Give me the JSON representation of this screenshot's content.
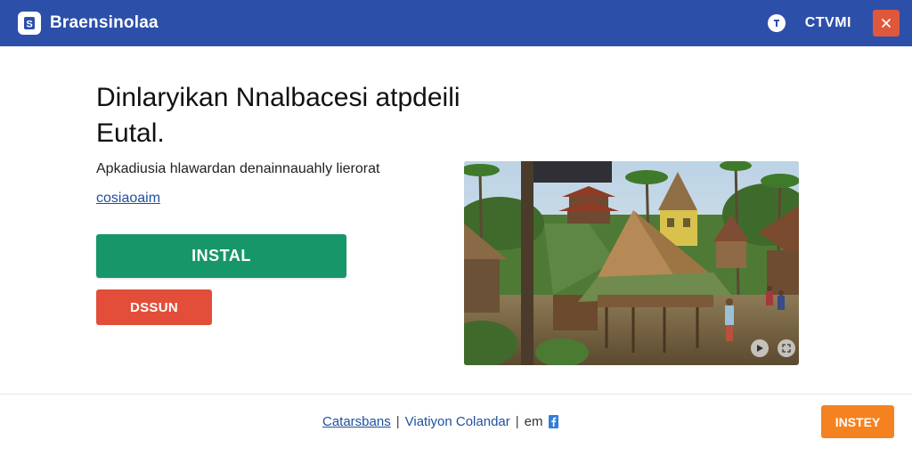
{
  "header": {
    "brand_name": "Braensinolaa",
    "account_label": "CTVMI",
    "colors": {
      "bar": "#2c4fa9",
      "close": "#e0583c"
    },
    "icons": {
      "logo": "brand-logo-icon",
      "help": "help-icon",
      "close": "close-icon"
    }
  },
  "main": {
    "headline_line1": "Dinlaryikan Nnalbacesi atpdeili",
    "headline_line2": "Eutal.",
    "description": "Apkadiusia hlawardan denainnauahly lierorat",
    "link_text": "cosiaoaim",
    "install_label": "INSTAL",
    "dismiss_label": "DSSUN",
    "colors": {
      "install": "#17966a",
      "dismiss": "#e24e3a",
      "link": "#1f4f9d"
    }
  },
  "photo": {
    "subject": "tropical village with thatched-roof wooden houses",
    "controls": [
      "play-icon",
      "expand-icon"
    ]
  },
  "footer": {
    "link1": "Catarsbans",
    "separator": "|",
    "link2": "Viatiyon Colandar",
    "item3": "em",
    "install_label": "INSTEY",
    "colors": {
      "install": "#f58220"
    }
  }
}
